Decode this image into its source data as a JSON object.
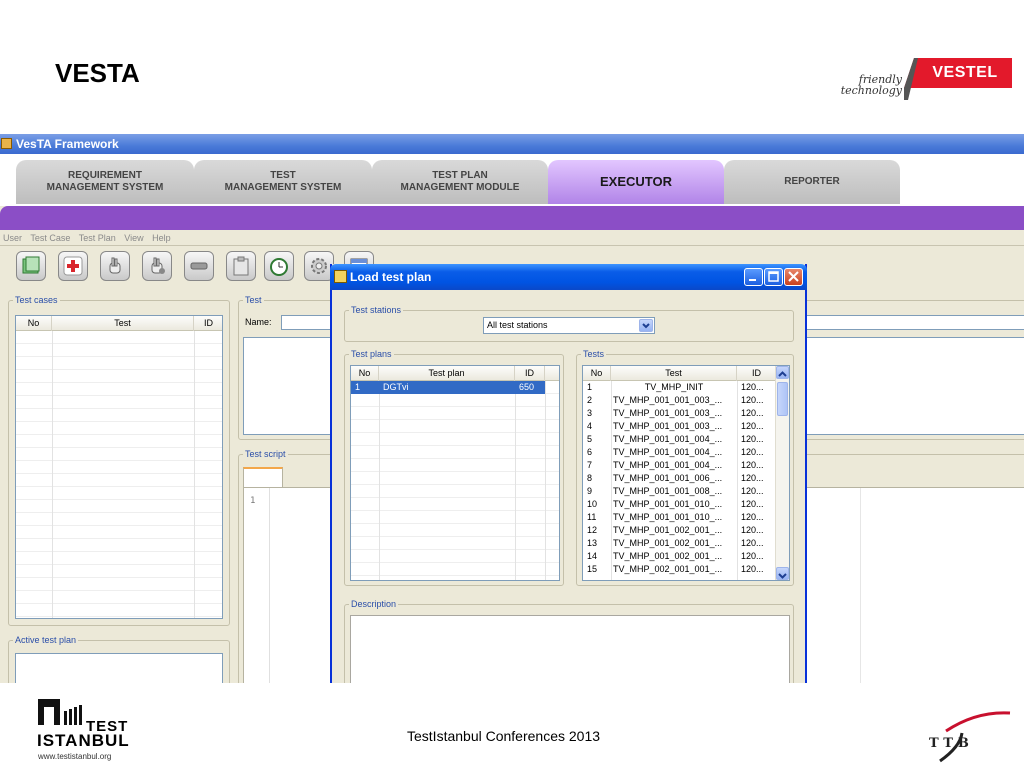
{
  "slide": {
    "title": "VESTA",
    "footer": "TestIstanbul Conferences 2013"
  },
  "vestel": {
    "tagline_1": "friendly",
    "tagline_2": "technology",
    "logo": "VESTEL",
    "accent": "#e3192b"
  },
  "testistanbul": {
    "word_1": "TEST",
    "word_2": "ISTANBUL",
    "url": "www.testistanbul.org"
  },
  "ttb": {
    "logo": "TTB"
  },
  "app": {
    "window_title": "VesTA Framework",
    "tabs": [
      {
        "label": "REQUIREMENT\nMANAGEMENT SYSTEM"
      },
      {
        "label": "TEST\nMANAGEMENT SYSTEM"
      },
      {
        "label": "TEST PLAN\nMANAGEMENT MODULE"
      },
      {
        "label": "EXECUTOR"
      },
      {
        "label": "REPORTER"
      }
    ],
    "accent": "#8b4ec6",
    "menu": [
      "User",
      "Test Case",
      "Test Plan",
      "View",
      "Help"
    ],
    "toolbar_icons": [
      "load-plan-icon",
      "add-icon",
      "hand-icon",
      "hand-run-icon",
      "remove-icon",
      "clipboard-icon",
      "clock-icon",
      "settings-icon",
      "window-icon"
    ],
    "test_cases": {
      "label": "Test cases",
      "columns": [
        "No",
        "Test",
        "ID"
      ]
    },
    "test_panel": {
      "label": "Test",
      "name_label": "Name:"
    },
    "test_script": {
      "label": "Test script",
      "line_no": "1"
    },
    "active_test_plan": {
      "label": "Active test plan"
    }
  },
  "dialog": {
    "title": "Load test plan",
    "test_stations": {
      "label": "Test stations",
      "selected": "All test stations"
    },
    "test_plans": {
      "label": "Test plans",
      "columns": [
        "No",
        "Test plan",
        "ID"
      ],
      "rows": [
        {
          "no": "1",
          "plan": "DGTvi",
          "id": "650"
        }
      ]
    },
    "tests": {
      "label": "Tests",
      "columns": [
        "No",
        "Test",
        "ID"
      ],
      "rows": [
        {
          "no": "1",
          "test": "TV_MHP_INIT",
          "id": "120..."
        },
        {
          "no": "2",
          "test": "TV_MHP_001_001_003_...",
          "id": "120..."
        },
        {
          "no": "3",
          "test": "TV_MHP_001_001_003_...",
          "id": "120..."
        },
        {
          "no": "4",
          "test": "TV_MHP_001_001_003_...",
          "id": "120..."
        },
        {
          "no": "5",
          "test": "TV_MHP_001_001_004_...",
          "id": "120..."
        },
        {
          "no": "6",
          "test": "TV_MHP_001_001_004_...",
          "id": "120..."
        },
        {
          "no": "7",
          "test": "TV_MHP_001_001_004_...",
          "id": "120..."
        },
        {
          "no": "8",
          "test": "TV_MHP_001_001_006_...",
          "id": "120..."
        },
        {
          "no": "9",
          "test": "TV_MHP_001_001_008_...",
          "id": "120..."
        },
        {
          "no": "10",
          "test": "TV_MHP_001_001_010_...",
          "id": "120..."
        },
        {
          "no": "11",
          "test": "TV_MHP_001_001_010_...",
          "id": "120..."
        },
        {
          "no": "12",
          "test": "TV_MHP_001_002_001_...",
          "id": "120..."
        },
        {
          "no": "13",
          "test": "TV_MHP_001_002_001_...",
          "id": "120..."
        },
        {
          "no": "14",
          "test": "TV_MHP_001_002_001_...",
          "id": "120..."
        },
        {
          "no": "15",
          "test": "TV_MHP_002_001_001_...",
          "id": "120..."
        }
      ]
    },
    "description": {
      "label": "Description"
    }
  }
}
